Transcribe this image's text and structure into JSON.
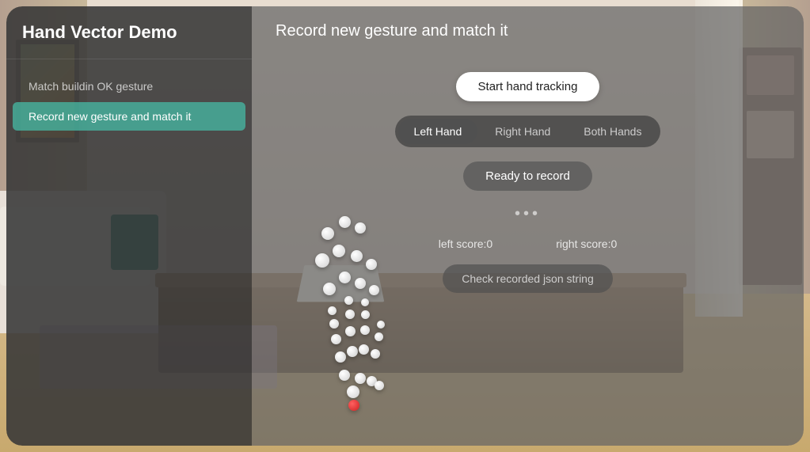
{
  "background": {
    "description": "Living room background"
  },
  "app": {
    "sidebar": {
      "title": "Hand Vector Demo",
      "items": [
        {
          "id": "match-buildin",
          "label": "Match buildin OK gesture",
          "active": false
        },
        {
          "id": "record-gesture",
          "label": "Record new gesture and match it",
          "active": true
        }
      ]
    },
    "main": {
      "title": "Record new gesture and match it",
      "start_tracking_label": "Start hand tracking",
      "hand_selector": {
        "options": [
          {
            "id": "left",
            "label": "Left Hand",
            "active": true
          },
          {
            "id": "right",
            "label": "Right Hand",
            "active": false
          },
          {
            "id": "both",
            "label": "Both Hands",
            "active": false
          }
        ]
      },
      "ready_label": "Ready to record",
      "dots": "•••",
      "scores": {
        "left": "left score:0",
        "right": "right score:0"
      },
      "check_json_label": "Check recorded json string"
    }
  }
}
